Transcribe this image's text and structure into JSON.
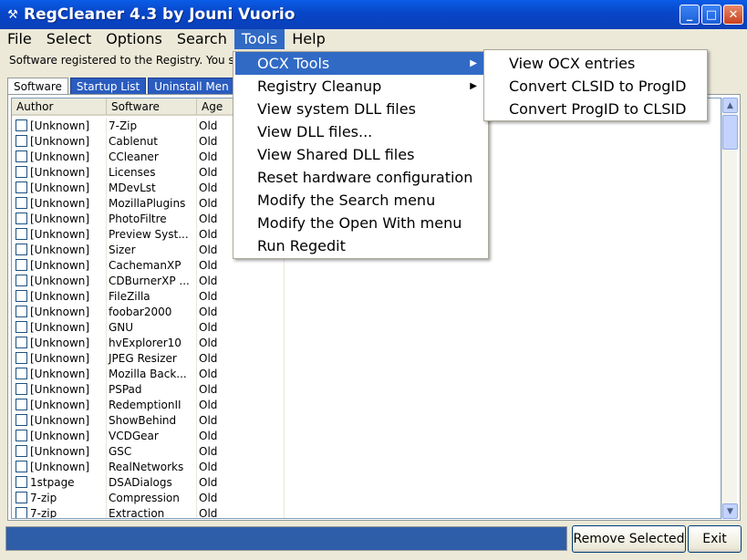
{
  "window": {
    "title": "RegCleaner 4.3 by Jouni Vuorio",
    "icon": "regcleaner-app-icon",
    "minimize_label": "_",
    "maximize_label": "□",
    "close_label": "✕"
  },
  "menubar": [
    "File",
    "Select",
    "Options",
    "Search",
    "Tools",
    "Help"
  ],
  "info_text": "Software registered to the Registry. You s",
  "tabs": [
    "Software",
    "Startup List",
    "Uninstall Men"
  ],
  "list": {
    "columns": [
      "Author",
      "Software",
      "Age"
    ],
    "rows": [
      {
        "author": "[Unknown]",
        "software": "7-Zip",
        "age": "Old"
      },
      {
        "author": "[Unknown]",
        "software": "Cablenut",
        "age": "Old"
      },
      {
        "author": "[Unknown]",
        "software": "CCleaner",
        "age": "Old"
      },
      {
        "author": "[Unknown]",
        "software": "Licenses",
        "age": "Old"
      },
      {
        "author": "[Unknown]",
        "software": "MDevLst",
        "age": "Old"
      },
      {
        "author": "[Unknown]",
        "software": "MozillaPlugins",
        "age": "Old"
      },
      {
        "author": "[Unknown]",
        "software": "PhotoFiltre",
        "age": "Old"
      },
      {
        "author": "[Unknown]",
        "software": "Preview Syst...",
        "age": "Old"
      },
      {
        "author": "[Unknown]",
        "software": "Sizer",
        "age": "Old"
      },
      {
        "author": "[Unknown]",
        "software": "CachemanXP",
        "age": "Old"
      },
      {
        "author": "[Unknown]",
        "software": "CDBurnerXP ...",
        "age": "Old"
      },
      {
        "author": "[Unknown]",
        "software": "FileZilla",
        "age": "Old"
      },
      {
        "author": "[Unknown]",
        "software": "foobar2000",
        "age": "Old"
      },
      {
        "author": "[Unknown]",
        "software": "GNU",
        "age": "Old"
      },
      {
        "author": "[Unknown]",
        "software": "hvExplorer10",
        "age": "Old"
      },
      {
        "author": "[Unknown]",
        "software": "JPEG Resizer",
        "age": "Old"
      },
      {
        "author": "[Unknown]",
        "software": "Mozilla Back...",
        "age": "Old"
      },
      {
        "author": "[Unknown]",
        "software": "PSPad",
        "age": "Old"
      },
      {
        "author": "[Unknown]",
        "software": "RedemptionII",
        "age": "Old"
      },
      {
        "author": "[Unknown]",
        "software": "ShowBehind",
        "age": "Old"
      },
      {
        "author": "[Unknown]",
        "software": "VCDGear",
        "age": "Old"
      },
      {
        "author": "[Unknown]",
        "software": "GSC",
        "age": "Old"
      },
      {
        "author": "[Unknown]",
        "software": "RealNetworks",
        "age": "Old"
      },
      {
        "author": "1stpage",
        "software": "DSADialogs",
        "age": "Old"
      },
      {
        "author": "7-zip",
        "software": "Compression",
        "age": "Old"
      },
      {
        "author": "7-zip",
        "software": "Extraction",
        "age": "Old"
      }
    ]
  },
  "tools_menu": [
    "OCX Tools",
    "Registry Cleanup",
    "View system DLL files",
    "View DLL files...",
    "View Shared DLL files",
    "Reset hardware configuration",
    "Modify the Search menu",
    "Modify the Open With menu",
    "Run Regedit"
  ],
  "ocx_submenu": [
    "View OCX entries",
    "Convert CLSID to ProgID",
    "Convert ProgID to CLSID"
  ],
  "buttons": {
    "remove_selected": "Remove Selected",
    "exit": "Exit"
  },
  "scroll_glyphs": {
    "up": "▲",
    "down": "▼"
  },
  "submenu_arrow": "▶",
  "colors": {
    "titlebar": "#0a5ce6",
    "highlight": "#316ac5",
    "statusbar": "#2f5ea8"
  }
}
